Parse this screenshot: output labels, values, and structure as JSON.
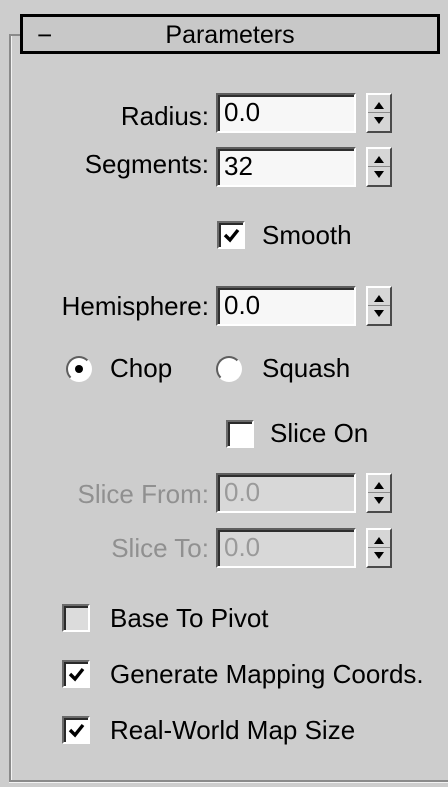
{
  "rollout": {
    "collapse_symbol": "−",
    "title": "Parameters"
  },
  "radius": {
    "label": "Radius:",
    "value": "0.0"
  },
  "segments": {
    "label": "Segments:",
    "value": "32"
  },
  "smooth": {
    "label": "Smooth",
    "checked": true
  },
  "hemisphere": {
    "label": "Hemisphere:",
    "value": "0.0"
  },
  "hemisphere_mode": {
    "options": [
      "Chop",
      "Squash"
    ],
    "selected": "Chop"
  },
  "slice_on": {
    "label": "Slice On",
    "checked": false
  },
  "slice_from": {
    "label": "Slice From:",
    "value": "0.0",
    "enabled": false
  },
  "slice_to": {
    "label": "Slice To:",
    "value": "0.0",
    "enabled": false
  },
  "base_to_pivot": {
    "label": "Base To Pivot",
    "checked": false
  },
  "generate_mapping_coords": {
    "label": "Generate Mapping Coords.",
    "checked": true
  },
  "real_world_map_size": {
    "label": "Real-World Map Size",
    "checked": true
  }
}
